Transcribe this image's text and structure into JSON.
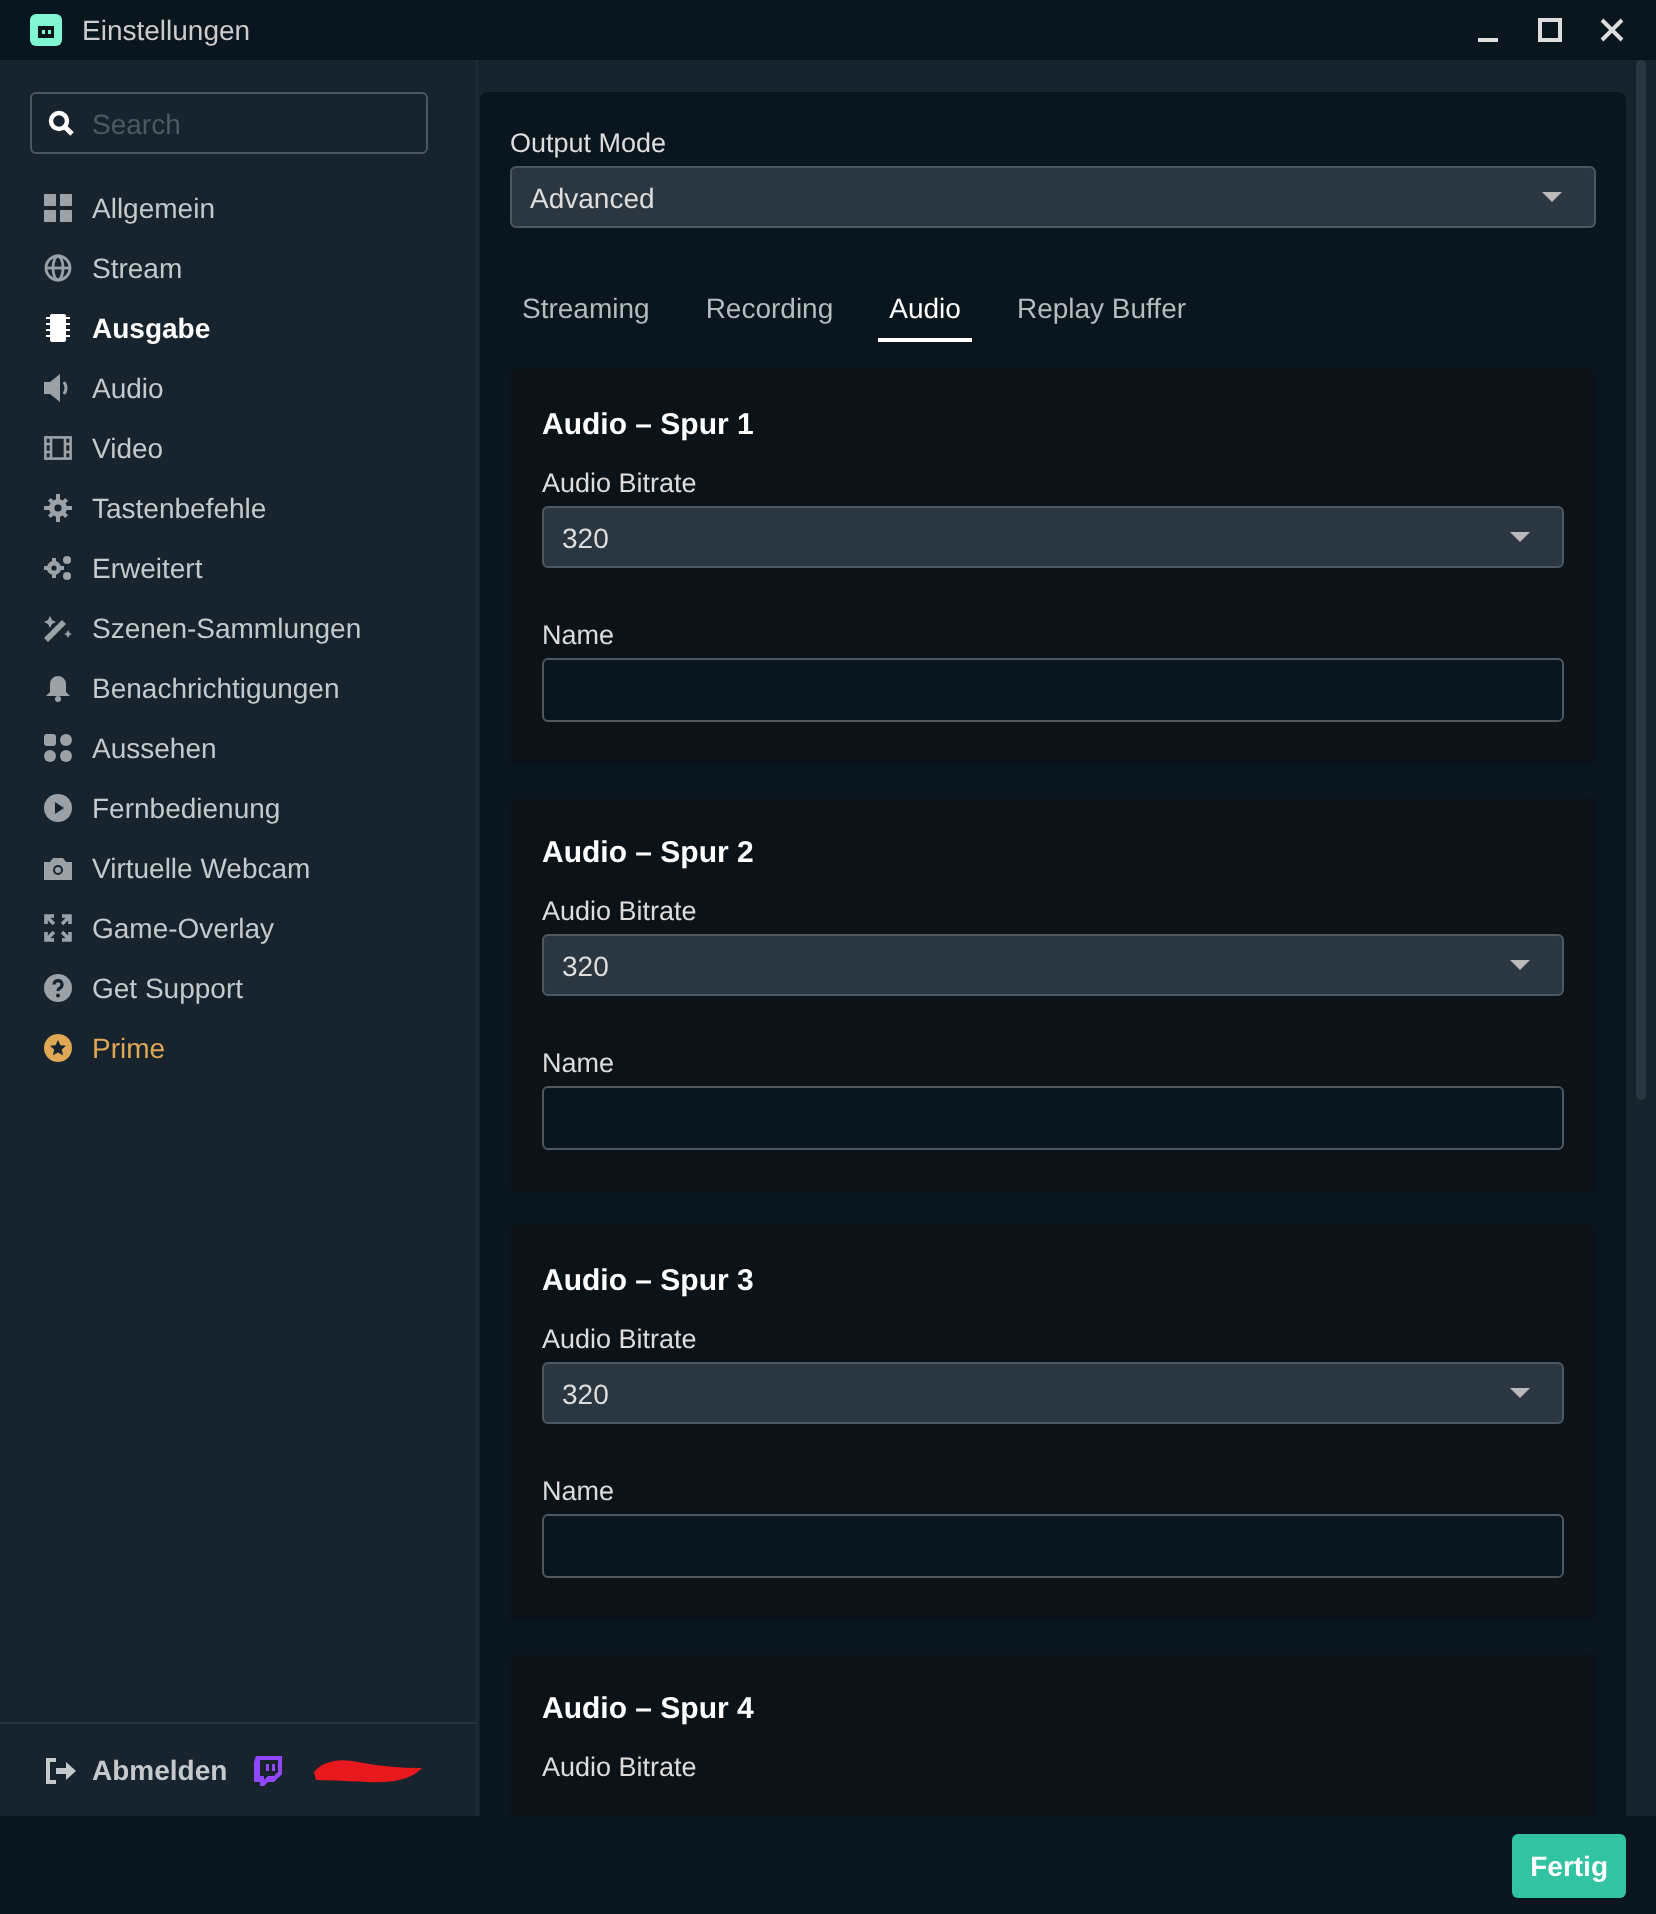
{
  "window": {
    "title": "Einstellungen"
  },
  "sidebar": {
    "search": {
      "placeholder": "Search"
    },
    "items": [
      {
        "label": "Allgemein",
        "kind": "grid",
        "selected": false,
        "premium": false
      },
      {
        "label": "Stream",
        "kind": "globe",
        "selected": false,
        "premium": false
      },
      {
        "label": "Ausgabe",
        "kind": "chip",
        "selected": true,
        "premium": false
      },
      {
        "label": "Audio",
        "kind": "speaker",
        "selected": false,
        "premium": false
      },
      {
        "label": "Video",
        "kind": "film",
        "selected": false,
        "premium": false
      },
      {
        "label": "Tastenbefehle",
        "kind": "gear",
        "selected": false,
        "premium": false
      },
      {
        "label": "Erweitert",
        "kind": "gears",
        "selected": false,
        "premium": false
      },
      {
        "label": "Szenen-Sammlungen",
        "kind": "wand",
        "selected": false,
        "premium": false
      },
      {
        "label": "Benachrichtigungen",
        "kind": "bell",
        "selected": false,
        "premium": false
      },
      {
        "label": "Aussehen",
        "kind": "shapes",
        "selected": false,
        "premium": false
      },
      {
        "label": "Fernbedienung",
        "kind": "play",
        "selected": false,
        "premium": false
      },
      {
        "label": "Virtuelle Webcam",
        "kind": "camera",
        "selected": false,
        "premium": false
      },
      {
        "label": "Game-Overlay",
        "kind": "expand",
        "selected": false,
        "premium": false
      },
      {
        "label": "Get Support",
        "kind": "help",
        "selected": false,
        "premium": false
      },
      {
        "label": "Prime",
        "kind": "star",
        "selected": false,
        "premium": true
      }
    ],
    "logout": {
      "label": "Abmelden"
    }
  },
  "output_mode": {
    "label": "Output Mode",
    "value": "Advanced"
  },
  "tabs": [
    {
      "label": "Streaming",
      "selected": false
    },
    {
      "label": "Recording",
      "selected": false
    },
    {
      "label": "Audio",
      "selected": true
    },
    {
      "label": "Replay Buffer",
      "selected": false
    }
  ],
  "tracks": [
    {
      "title": "Audio – Spur 1",
      "bitrate_label": "Audio Bitrate",
      "bitrate": "320",
      "name_label": "Name"
    },
    {
      "title": "Audio – Spur 2",
      "bitrate_label": "Audio Bitrate",
      "bitrate": "320",
      "name_label": "Name"
    },
    {
      "title": "Audio – Spur 3",
      "bitrate_label": "Audio Bitrate",
      "bitrate": "320",
      "name_label": "Name"
    },
    {
      "title": "Audio – Spur 4",
      "bitrate_label": "Audio Bitrate"
    }
  ],
  "footer": {
    "done_button": "Fertig"
  }
}
